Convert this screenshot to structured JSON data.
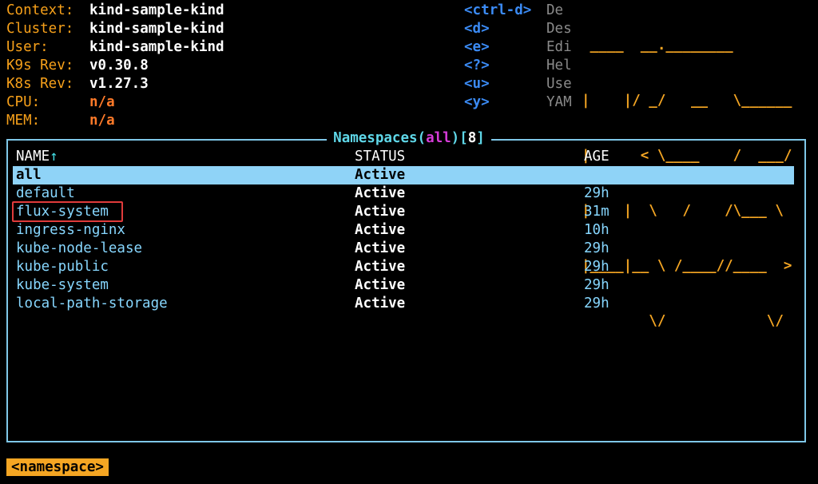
{
  "header": {
    "info": [
      {
        "label": "Context:",
        "value": "kind-sample-kind",
        "accent": "white"
      },
      {
        "label": "Cluster:",
        "value": "kind-sample-kind",
        "accent": "white"
      },
      {
        "label": "User:",
        "value": "kind-sample-kind",
        "accent": "white"
      },
      {
        "label": "K9s Rev:",
        "value": "v0.30.8",
        "accent": "white"
      },
      {
        "label": "K8s Rev:",
        "value": "v1.27.3",
        "accent": "white"
      },
      {
        "label": "CPU:",
        "value": "n/a",
        "accent": "orange"
      },
      {
        "label": "MEM:",
        "value": "n/a",
        "accent": "orange"
      }
    ],
    "keys": [
      {
        "key": "<ctrl-d>",
        "desc": "De"
      },
      {
        "key": "<d>",
        "desc": "Des"
      },
      {
        "key": "<e>",
        "desc": "Edi"
      },
      {
        "key": "<?>",
        "desc": "Hel"
      },
      {
        "key": "<u>",
        "desc": "Use"
      },
      {
        "key": "<y>",
        "desc": "YAM"
      }
    ],
    "logo_lines": [
      " ____  __.________       ",
      "|    |/ _/   __   \\______",
      "|      < \\____    /  ___/",
      "|    |  \\   /    /\\___ \\ ",
      "|____|__ \\ /____//____  >",
      "        \\/            \\/ "
    ]
  },
  "table": {
    "title_prefix": "Namespaces(",
    "title_filter": "all",
    "title_mid": ")[",
    "title_count": "8",
    "title_suffix": "]",
    "columns": {
      "name": "NAME",
      "sort_icon": "↑",
      "status": "STATUS",
      "age": "AGE"
    },
    "rows": [
      {
        "name": "all",
        "status": "Active",
        "age": ""
      },
      {
        "name": "default",
        "status": "Active",
        "age": "29h"
      },
      {
        "name": "flux-system",
        "status": "Active",
        "age": "31m"
      },
      {
        "name": "ingress-nginx",
        "status": "Active",
        "age": "10h"
      },
      {
        "name": "kube-node-lease",
        "status": "Active",
        "age": "29h"
      },
      {
        "name": "kube-public",
        "status": "Active",
        "age": "29h"
      },
      {
        "name": "kube-system",
        "status": "Active",
        "age": "29h"
      },
      {
        "name": "local-path-storage",
        "status": "Active",
        "age": "29h"
      }
    ],
    "selected_index": 0,
    "highlighted_row": 2
  },
  "breadcrumb": "<namespace>",
  "colors": {
    "label": "#f6a01a",
    "key": "#3b8bf5",
    "logo": "#f5a623",
    "border": "#7fc7e8",
    "row_text": "#87d7ff",
    "selected_bg": "#8fd3f7",
    "highlight": "#e03b3b"
  }
}
